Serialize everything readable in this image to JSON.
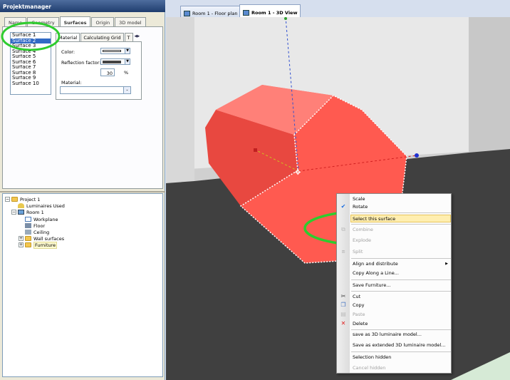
{
  "project_manager": {
    "title": "Projektmanager",
    "tabs": [
      "Name",
      "Geometry",
      "Surfaces",
      "Origin",
      "3D model"
    ],
    "active_tab": "Surfaces",
    "surfaces": [
      "Surface 1",
      "Surface 2",
      "Surface 3",
      "Surface 4",
      "Surface 5",
      "Surface 6",
      "Surface 7",
      "Surface 8",
      "Surface 9",
      "Surface 10"
    ],
    "selected_surface": "Surface 2",
    "inner_tabs": [
      "Material",
      "Calculating Grid",
      "T"
    ],
    "color_label": "Color:",
    "reflection_label": "Reflection factor:",
    "reflection_value": "30",
    "reflection_unit": "%",
    "material_label": "Material:",
    "material_value": ""
  },
  "tree": {
    "project": "Project 1",
    "luminaires": "Luminaires Used",
    "room": "Room 1",
    "workplane": "Workplane",
    "floor": "Floor",
    "ceiling": "Ceiling",
    "wall_surfaces": "Wall surfaces",
    "furniture": "Furniture"
  },
  "doc_tabs": {
    "floor_plan": "Room 1 - Floor plan",
    "view3d": "Room 1 - 3D View"
  },
  "context_menu": {
    "items": [
      {
        "label": "Scale",
        "enabled": true
      },
      {
        "label": "Rotate",
        "enabled": true,
        "checked": true
      },
      {
        "label": "Select this surface",
        "enabled": true,
        "highlighted": true
      },
      {
        "label": "Combine",
        "enabled": false
      },
      {
        "label": "Explode",
        "enabled": false
      },
      {
        "label": "Split",
        "enabled": false
      },
      {
        "label": "Align and distribute",
        "enabled": true,
        "submenu": true
      },
      {
        "label": "Copy Along a Line...",
        "enabled": true
      },
      {
        "label": "Save Furniture...",
        "enabled": true
      },
      {
        "label": "Cut",
        "enabled": true
      },
      {
        "label": "Copy",
        "enabled": true
      },
      {
        "label": "Paste",
        "enabled": false
      },
      {
        "label": "Delete",
        "enabled": true
      },
      {
        "label": "save as 3D luminaire model...",
        "enabled": true
      },
      {
        "label": "Save as extended 3D luminaire model...",
        "enabled": true
      },
      {
        "label": "Selection hidden",
        "enabled": true
      },
      {
        "label": "Cancel hidden",
        "enabled": false
      }
    ]
  },
  "colors": {
    "object": "#ff5a50",
    "highlight_circle": "#2ecc2e",
    "floor": "#404040",
    "wall": "#c8c8c8"
  }
}
